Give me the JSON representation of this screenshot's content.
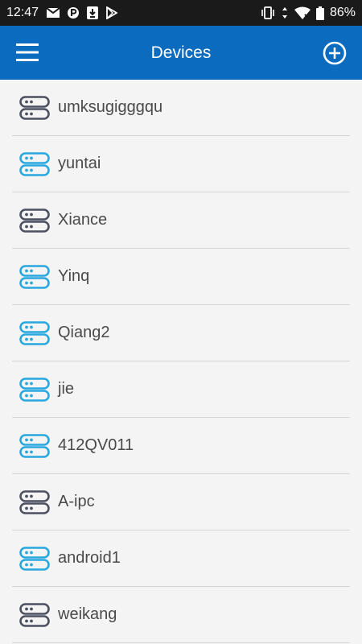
{
  "status_bar": {
    "time": "12:47",
    "battery": "86%",
    "notification_icons": [
      "mail-icon",
      "parking-icon",
      "download-icon",
      "play-store-icon"
    ],
    "system_icons": [
      "vibrate-icon",
      "data-arrows-icon",
      "wifi-icon",
      "battery-icon"
    ]
  },
  "app_bar": {
    "title": "Devices",
    "menu_icon": "hamburger-menu-icon",
    "add_icon": "add-circle-icon",
    "color": "#0a6bbf"
  },
  "colors": {
    "online": "#29a8e0",
    "offline": "#4d5060"
  },
  "devices": [
    {
      "name": "umksugigggqu",
      "status": "offline"
    },
    {
      "name": "yuntai",
      "status": "online"
    },
    {
      "name": "Xiance",
      "status": "offline"
    },
    {
      "name": "Yinq",
      "status": "online"
    },
    {
      "name": "Qiang2",
      "status": "online"
    },
    {
      "name": "jie",
      "status": "online"
    },
    {
      "name": "412QV011",
      "status": "online"
    },
    {
      "name": "A-ipc",
      "status": "offline"
    },
    {
      "name": "android1",
      "status": "online"
    },
    {
      "name": "weikang",
      "status": "offline"
    }
  ]
}
